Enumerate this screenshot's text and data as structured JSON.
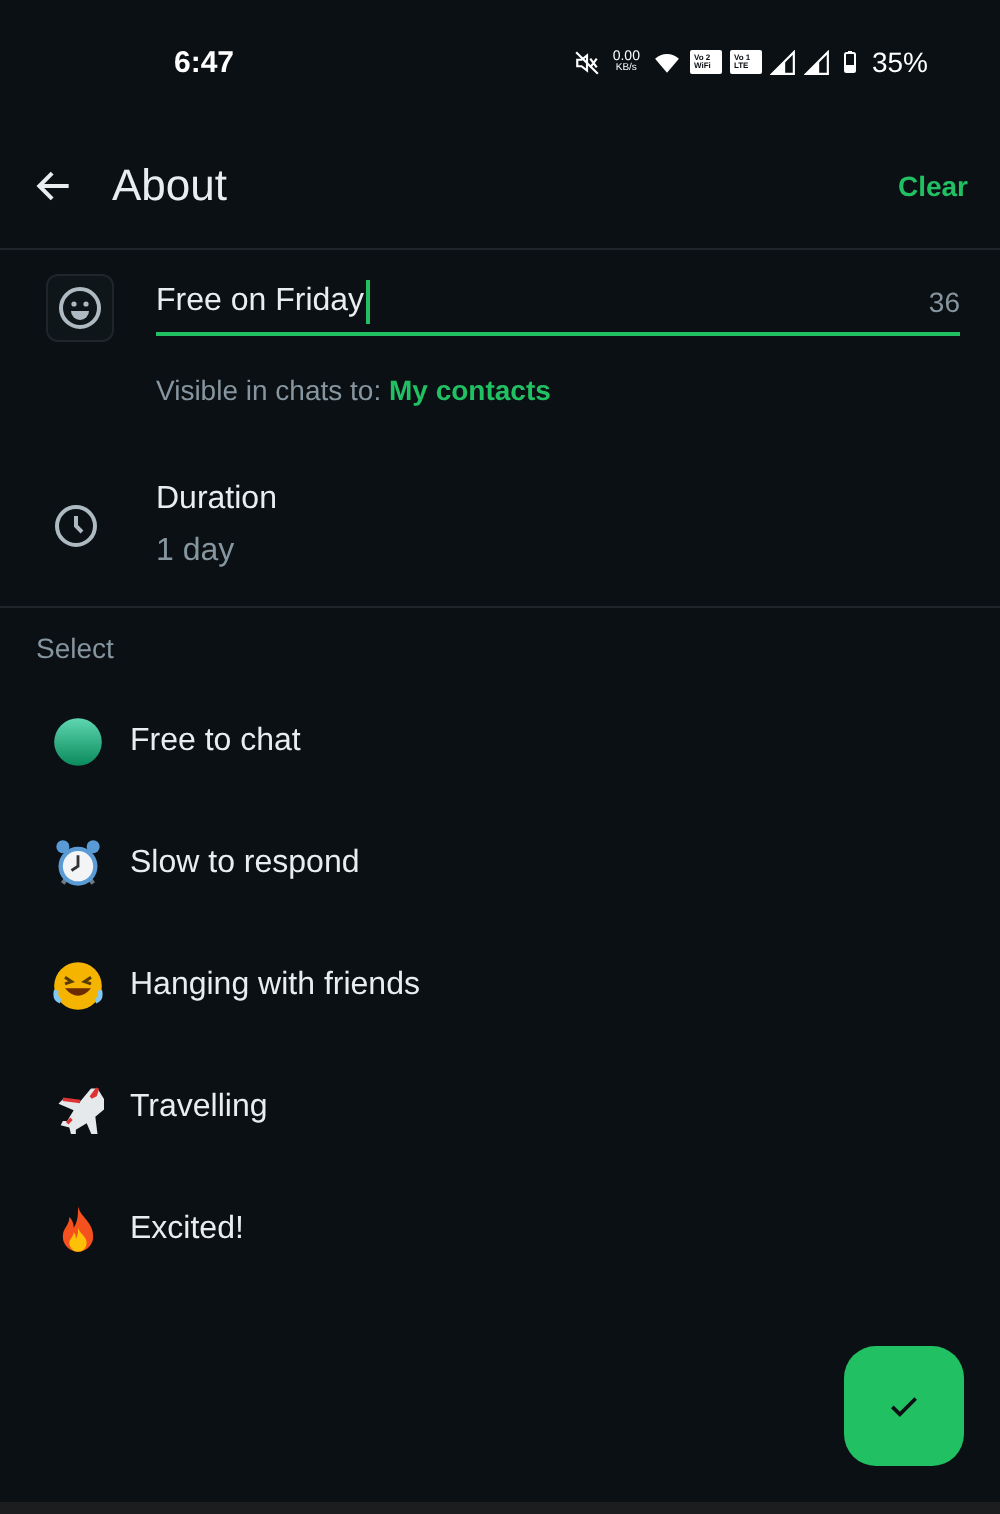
{
  "status_bar": {
    "time": "6:47",
    "speed_value": "0.00",
    "speed_unit": "KB/s",
    "sims": [
      {
        "top": "Vo 2",
        "bottom": "WiFi"
      },
      {
        "top": "Vo 1",
        "bottom": "LTE"
      }
    ],
    "battery": "35%"
  },
  "header": {
    "title": "About",
    "action": "Clear"
  },
  "about_field": {
    "value": "Free on Friday",
    "counter": "36"
  },
  "visibility": {
    "label": "Visible in chats to:",
    "value": "My contacts"
  },
  "duration": {
    "label": "Duration",
    "value": "1 day"
  },
  "section_label": "Select",
  "options": [
    {
      "kind": "circle",
      "label": "Free to chat"
    },
    {
      "kind": "alarm",
      "label": "Slow to respond"
    },
    {
      "kind": "laugh",
      "label": "Hanging with friends"
    },
    {
      "kind": "plane",
      "label": "Travelling"
    },
    {
      "kind": "fire",
      "label": "Excited!"
    }
  ]
}
